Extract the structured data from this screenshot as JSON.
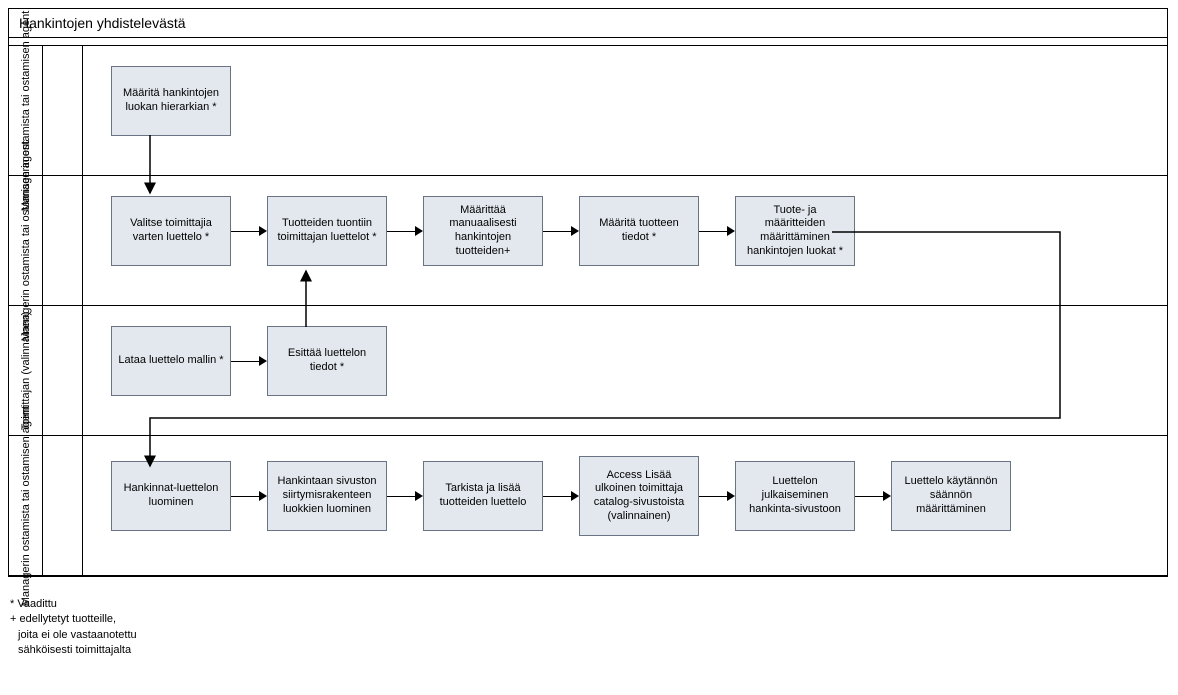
{
  "title": "Hankintojen yhdistelevästä",
  "lanes": {
    "lane1": {
      "label": "Managerin ostamista tai ostamisen agent"
    },
    "lane2": {
      "label": "Managerin ostamista tai ostamisen agent"
    },
    "lane3": {
      "label": "Toimittajan (valinnainen)"
    },
    "lane4": {
      "label": "Managerin ostamista tai ostamisen agent"
    }
  },
  "boxes": {
    "b1": "Määritä hankintojen luokan hierarkian *",
    "b2": "Valitse toimittajia varten luettelo *",
    "b3": "Tuotteiden tuontiin toimittajan luettelot *",
    "b4": "Määrittää manuaalisesti hankintojen tuotteiden+",
    "b5": "Määritä tuotteen tiedot *",
    "b6": "Tuote- ja määritteiden määrittäminen hankintojen luokat *",
    "b7": "Lataa luettelo mallin *",
    "b8": "Esittää luettelon tiedot *",
    "b9": "Hankinnat-luettelon luominen",
    "b10": "Hankintaan sivuston siirtymisrakenteen luokkien luominen",
    "b11": "Tarkista ja lisää tuotteiden luettelo",
    "b12": "Access Lisää ulkoinen toimittaja catalog-sivustoista (valinnainen)",
    "b13": "Luettelon julkaiseminen hankinta-sivustoon",
    "b14": "Luettelo käytännön säännön määrittäminen"
  },
  "footnotes": {
    "f1": "*  Vaadittu",
    "f2": "+ edellytetyt tuotteille,",
    "f3": "joita ei ole vastaanotettu",
    "f4": "sähköisesti toimittajalta"
  }
}
